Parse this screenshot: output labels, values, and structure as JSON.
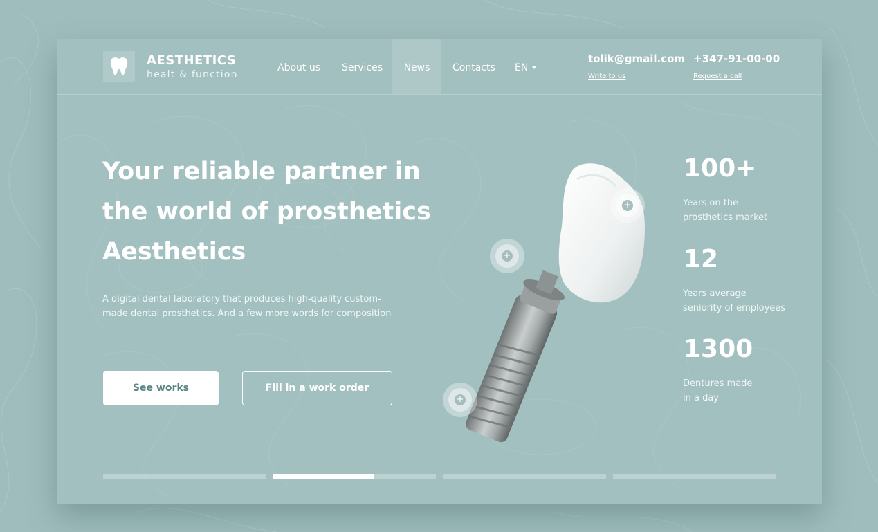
{
  "brand": {
    "name": "AESTHETICS",
    "tagline": "healt & function",
    "icon": "tooth-icon"
  },
  "nav": {
    "items": [
      {
        "label": "About us"
      },
      {
        "label": "Services"
      },
      {
        "label": "News",
        "active": true
      },
      {
        "label": "Contacts"
      }
    ],
    "language": "EN"
  },
  "contacts": {
    "email": "tolik@gmail.com",
    "email_link": "Write to us",
    "phone": "+347-91-00-00",
    "phone_link": "Request a call"
  },
  "hero": {
    "title_lines": [
      "Your reliable partner in",
      "the world of prosthetics",
      "Aesthetics"
    ],
    "description": "A digital dental laboratory that produces high-quality custom-made dental prosthetics. And a few more words for composition",
    "primary_button": "See works",
    "secondary_button": "Fill in a work order",
    "hotspot_symbol": "+"
  },
  "stats": [
    {
      "value": "100+",
      "label": "Years on the\nprosthetics market"
    },
    {
      "value": "12",
      "label": "Years average\nseniority of employees"
    },
    {
      "value": "1300",
      "label": "Dentures made\n in a day"
    }
  ],
  "slider": {
    "count": 4,
    "active_index": 1,
    "active_progress": 0.62
  },
  "colors": {
    "background": "#9fbdbd",
    "card": "#a3c0c0",
    "accent_text": "#ffffff",
    "button_text": "#5d8585"
  }
}
